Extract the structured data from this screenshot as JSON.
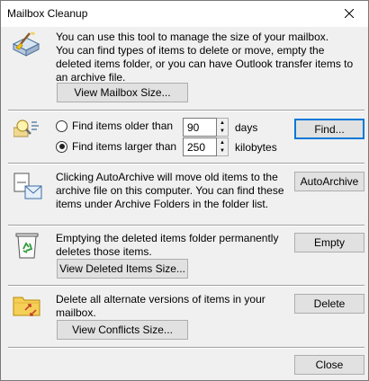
{
  "window": {
    "title": "Mailbox Cleanup"
  },
  "mailbox_size": {
    "description": "You can use this tool to manage the size of your mailbox.",
    "description2": "You can find types of items to delete or move, empty the deleted items folder, or you can have Outlook transfer items to an archive file.",
    "button_label": "View Mailbox Size..."
  },
  "find": {
    "older_label": "Find items older than",
    "older_value": "90",
    "older_unit": "days",
    "larger_label": "Find items larger than",
    "larger_value": "250",
    "larger_unit": "kilobytes",
    "selected": "larger",
    "button_label": "Find..."
  },
  "autoarchive": {
    "description": "Clicking AutoArchive will move old items to the archive file on this computer. You can find these items under Archive Folders in the folder list.",
    "button_label": "AutoArchive"
  },
  "deleted_items": {
    "description": "Emptying the deleted items folder permanently deletes those items.",
    "view_button_label": "View Deleted Items Size...",
    "button_label": "Empty"
  },
  "conflicts": {
    "description": "Delete all alternate versions of items in your mailbox.",
    "view_button_label": "View Conflicts Size...",
    "button_label": "Delete"
  },
  "footer": {
    "close_label": "Close"
  }
}
